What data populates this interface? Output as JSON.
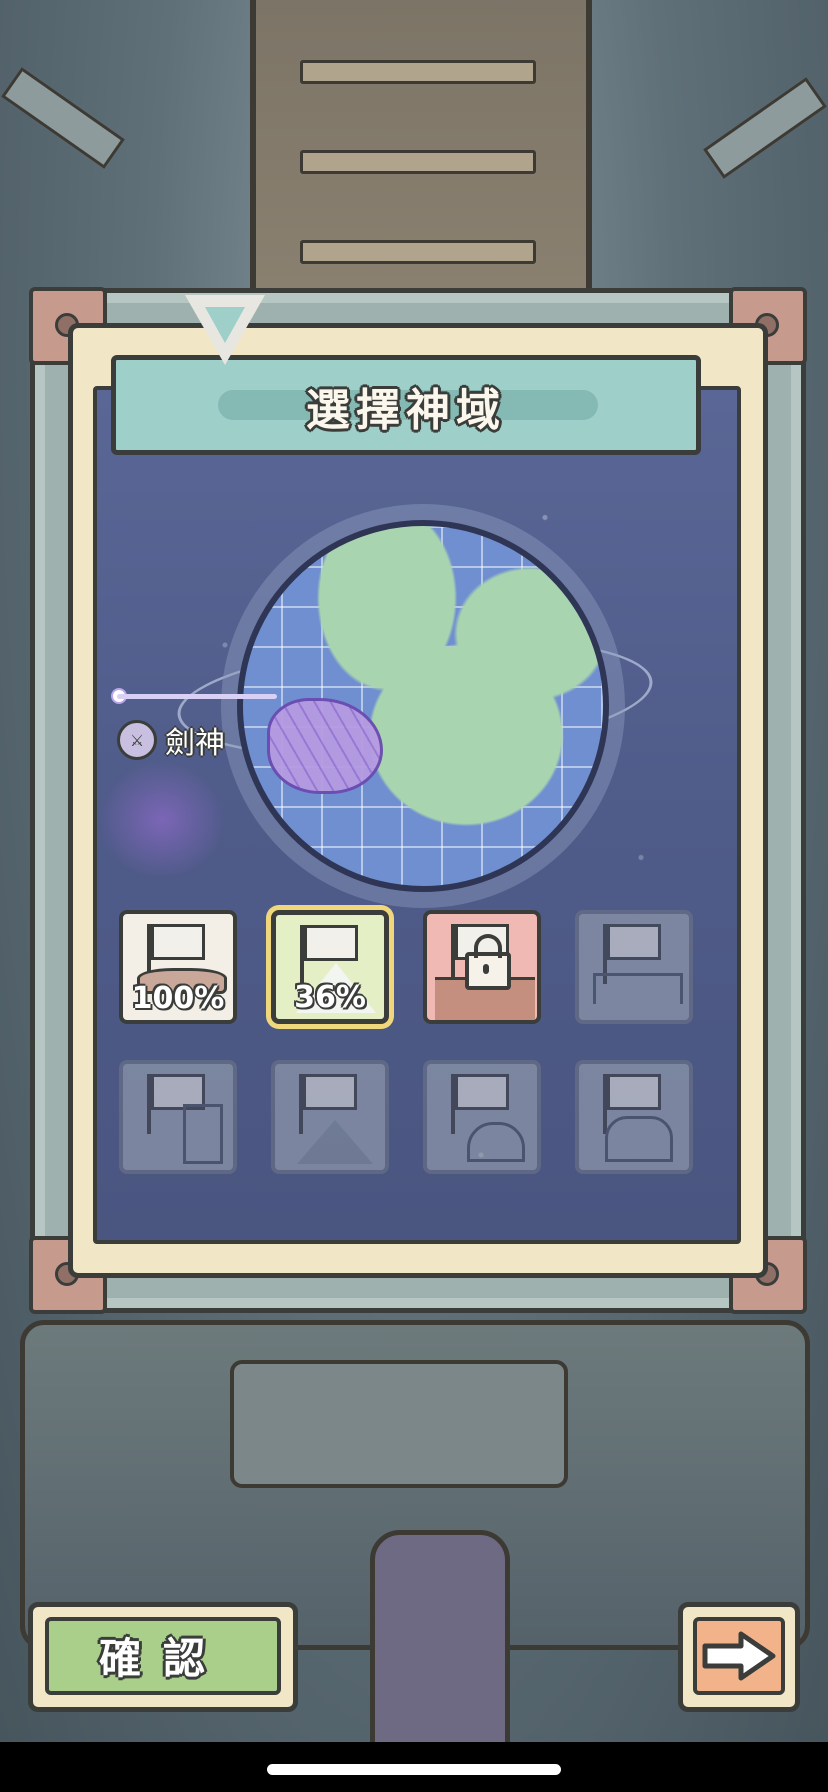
{
  "screen": {
    "title": "選擇神域"
  },
  "map": {
    "region_label": "劍神",
    "region_icon": "sword-emblem-icon"
  },
  "domains": [
    {
      "state": "completed",
      "progress": "100%",
      "icon": "flag-shrine-icon"
    },
    {
      "state": "selected",
      "progress": "36%",
      "icon": "flag-mountain-icon"
    },
    {
      "state": "locked",
      "progress": "",
      "icon": "lock-icon"
    },
    {
      "state": "unavailable",
      "progress": "",
      "icon": "flag-bridge-icon"
    },
    {
      "state": "unavailable",
      "progress": "",
      "icon": "flag-clocktower-icon"
    },
    {
      "state": "unavailable",
      "progress": "",
      "icon": "flag-pyramid-icon"
    },
    {
      "state": "unavailable",
      "progress": "",
      "icon": "flag-dome-icon"
    },
    {
      "state": "unavailable",
      "progress": "",
      "icon": "flag-palace-icon"
    }
  ],
  "actions": {
    "confirm_label": "確認",
    "next_icon": "arrow-right-icon"
  },
  "colors": {
    "panel_cream": "#f1e6c6",
    "title_teal": "#9ecfc8",
    "space_blue": "#4f5b89",
    "confirm_green": "#a9cf8a",
    "next_orange": "#f3b38a",
    "selected_outline": "#f0d77c",
    "locked_red": "#f0b9b4"
  }
}
